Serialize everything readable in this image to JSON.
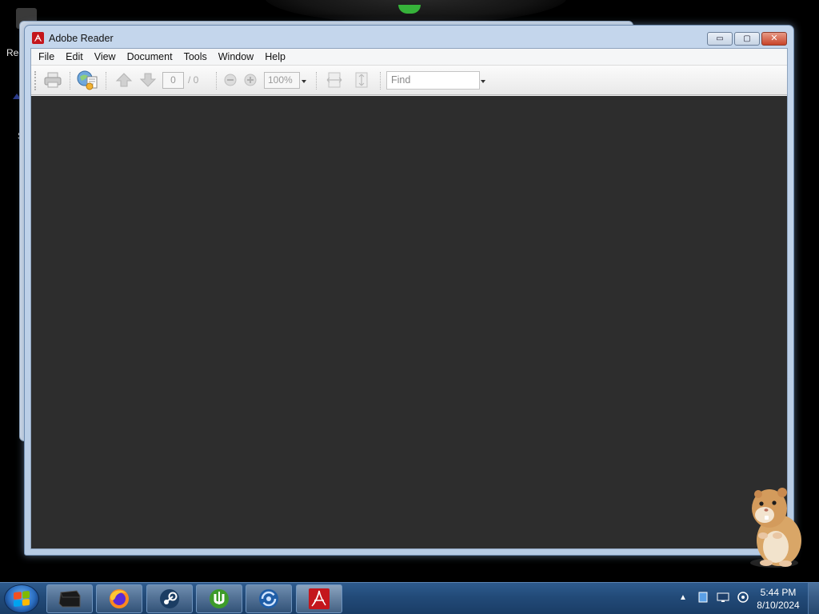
{
  "desktop": {
    "partial_label_1": "Rec",
    "partial_label_2": "S"
  },
  "window": {
    "title": "Adobe Reader",
    "minimize_label": "▭",
    "maximize_label": "▢",
    "close_label": "✕"
  },
  "menu": [
    "File",
    "Edit",
    "View",
    "Document",
    "Tools",
    "Window",
    "Help"
  ],
  "toolbar": {
    "page_number": "0",
    "page_total": "/ 0",
    "zoom": "100%",
    "find_placeholder": "Find"
  },
  "taskbar": {
    "apps": [
      "explorer",
      "firefox",
      "steam",
      "utorrent",
      "sync-app",
      "adobe-reader"
    ],
    "active_app": "adobe-reader"
  },
  "clock": {
    "time": "5:44 PM",
    "date": "8/10/2024"
  },
  "colors": {
    "document_background": "#2d2d2d",
    "adobe_red": "#c4161c",
    "taskbar": "#224a78"
  }
}
